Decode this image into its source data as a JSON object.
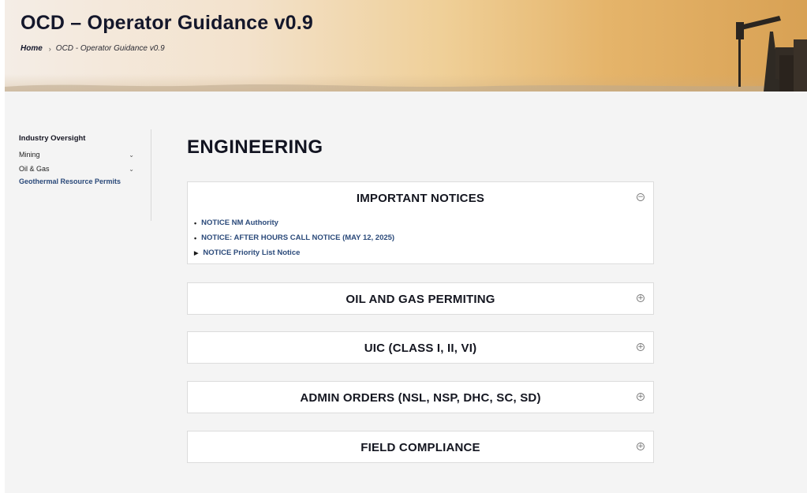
{
  "hero": {
    "title": "OCD – Operator Guidance v0.9",
    "breadcrumb": {
      "home": "Home",
      "separator": "›",
      "current": "OCD - Operator Guidance v0.9"
    }
  },
  "sidebar": {
    "heading": "Industry Oversight",
    "items": [
      {
        "label": "Mining",
        "icon": "chevron-down-icon"
      },
      {
        "label": "Oil & Gas",
        "icon": "chevron-down-icon"
      }
    ],
    "link": "Geothermal Resource Permits"
  },
  "main": {
    "title": "ENGINEERING",
    "panels": [
      {
        "title": "IMPORTANT NOTICES",
        "toggle": "⊖",
        "expanded": true,
        "notices": [
          {
            "marker": "•",
            "label": "NOTICE NM Authority"
          },
          {
            "marker": "•",
            "label": "NOTICE: AFTER HOURS CALL NOTICE (MAY 12, 2025)"
          },
          {
            "marker": "▶",
            "label": "NOTICE Priority List Notice"
          }
        ]
      },
      {
        "title": "OIL AND GAS PERMITING",
        "toggle": "⊕",
        "expanded": false
      },
      {
        "title": "UIC (CLASS I, II, VI)",
        "toggle": "⊕",
        "expanded": false
      },
      {
        "title": "ADMIN ORDERS (NSL, NSP, DHC, SC, SD)",
        "toggle": "⊕",
        "expanded": false
      },
      {
        "title": "FIELD COMPLIANCE",
        "toggle": "⊕",
        "expanded": false
      }
    ]
  },
  "colors": {
    "link": "#2b4a7a",
    "title": "#14172b",
    "hero_gold": "#e5b46a"
  }
}
